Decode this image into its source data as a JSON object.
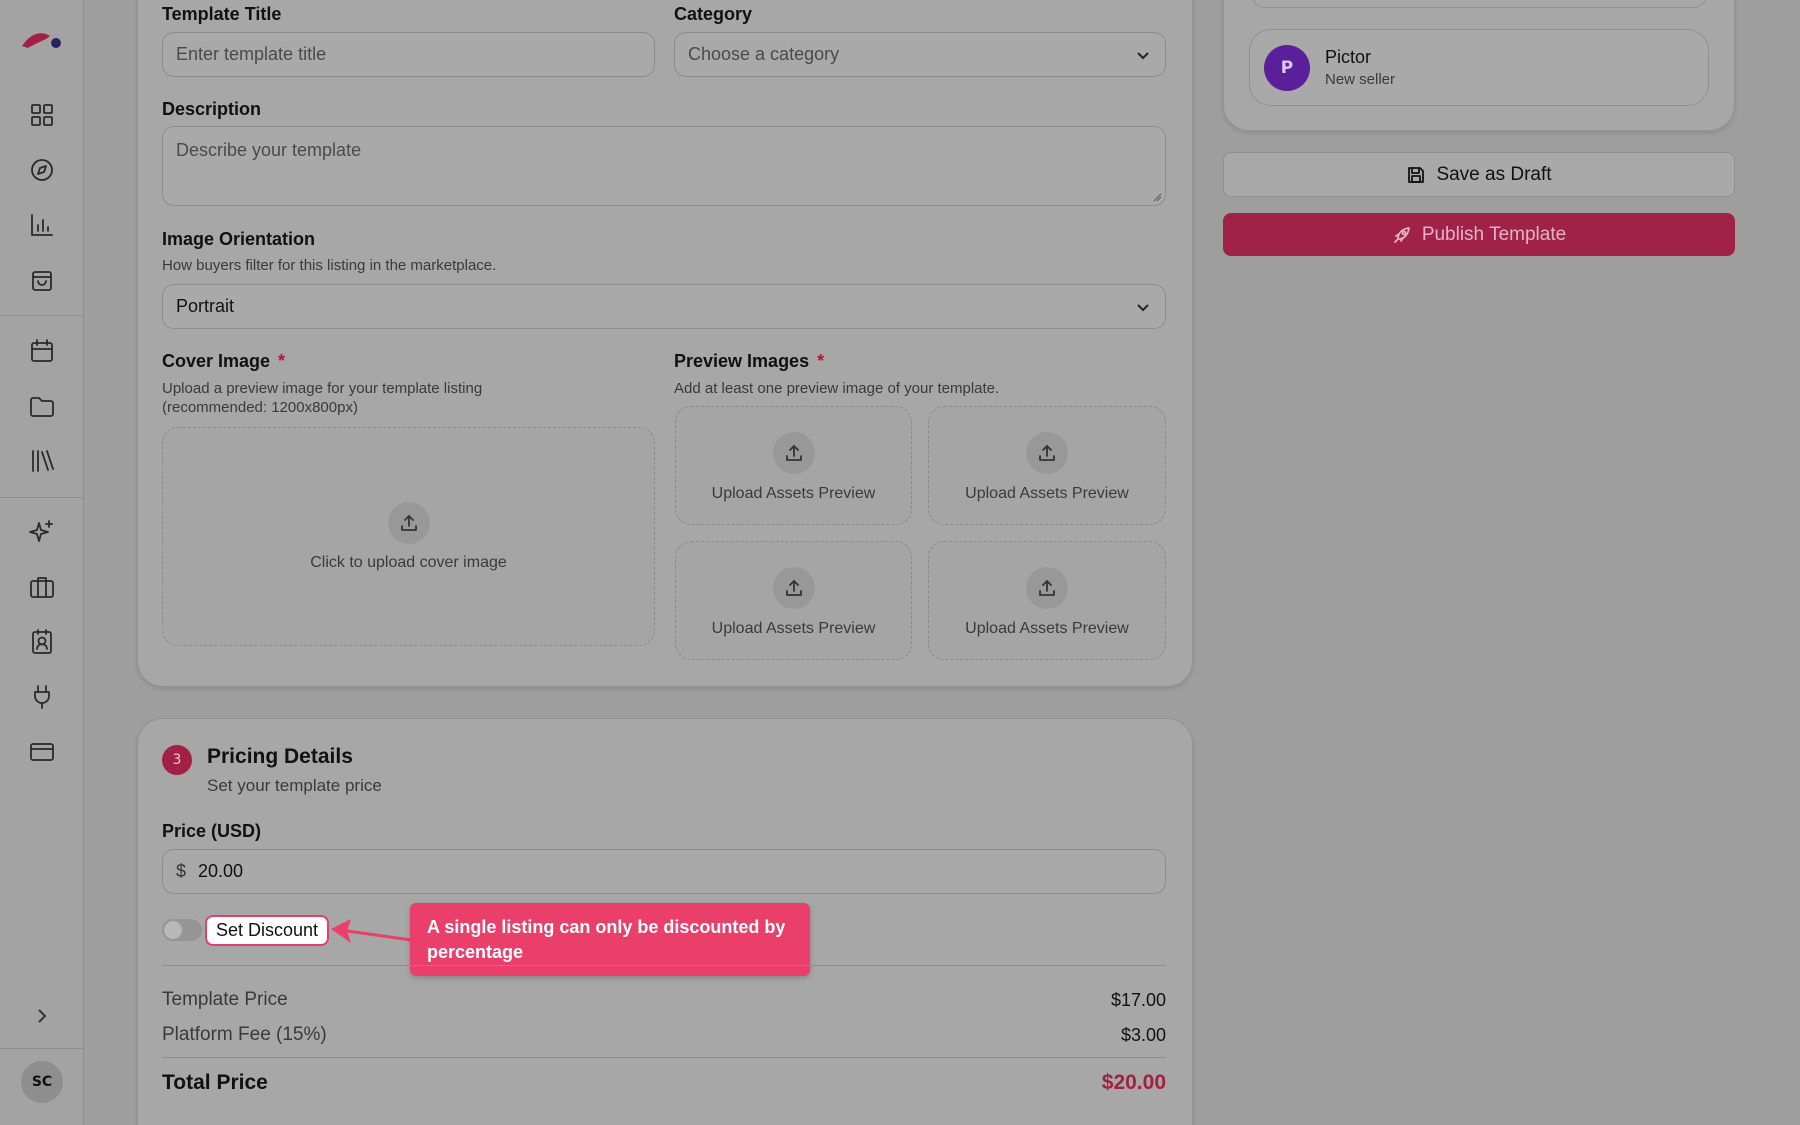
{
  "sidebar": {
    "icons": [
      "logo-icon",
      "dashboard-icon",
      "compass-icon",
      "chart-icon",
      "shopping-bag-icon",
      "calendar-icon",
      "folder-icon",
      "library-icon",
      "sparkles-icon",
      "briefcase-icon",
      "contact-icon",
      "plug-icon",
      "credit-card-icon",
      "chevron-right-icon"
    ],
    "avatar_initials": "SC"
  },
  "form": {
    "title_label": "Template Title",
    "title_placeholder": "Enter template title",
    "category_label": "Category",
    "category_placeholder": "Choose a category",
    "description_label": "Description",
    "description_placeholder": "Describe your template",
    "orientation_label": "Image Orientation",
    "orientation_hint": "How buyers filter for this listing in the marketplace.",
    "orientation_value": "Portrait",
    "cover_label": "Cover Image",
    "required_mark": "*",
    "cover_hint_1": "Upload a preview image for your template listing",
    "cover_hint_2": "(recommended: 1200x800px)",
    "cover_upload_text": "Click to upload cover image",
    "preview_label": "Preview Images",
    "preview_hint": "Add at least one preview image of your template.",
    "preview_upload_text": "Upload Assets Preview"
  },
  "pricing": {
    "step_number": "3",
    "title": "Pricing Details",
    "subtitle": "Set your template price",
    "price_label": "Price (USD)",
    "currency_symbol": "$",
    "price_value": "20.00",
    "discount_label": "Set Discount",
    "tooltip": "A single listing can only be discounted by percentage",
    "template_price_label": "Template Price",
    "template_price_value": "$17.00",
    "platform_fee_label": "Platform Fee (15%)",
    "platform_fee_value": "$3.00",
    "total_label": "Total Price",
    "total_value": "$20.00"
  },
  "side": {
    "seller_initial": "P",
    "seller_name": "Pictor",
    "seller_role": "New seller",
    "save_draft_label": "Save as Draft",
    "publish_label": "Publish Template"
  },
  "colors": {
    "accent": "#a21f45",
    "tooltip_bg": "#ea3f6a",
    "seller_avatar": "#5a1f9a"
  }
}
